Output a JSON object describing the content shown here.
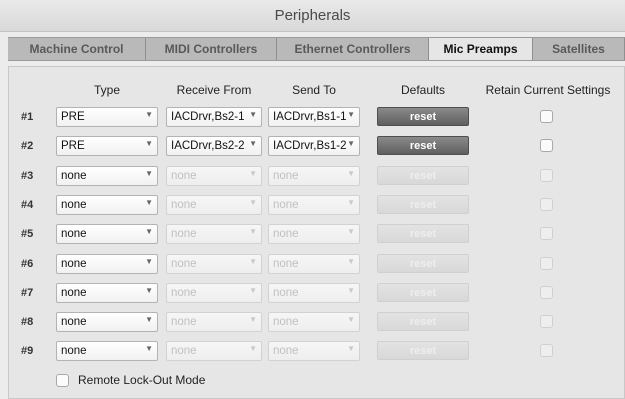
{
  "window": {
    "title": "Peripherals"
  },
  "tabs": [
    {
      "label": "Machine Control"
    },
    {
      "label": "MIDI Controllers"
    },
    {
      "label": "Ethernet Controllers"
    },
    {
      "label": "Mic Preamps",
      "active": true
    },
    {
      "label": "Satellites"
    }
  ],
  "headers": {
    "type": "Type",
    "receive": "Receive From",
    "send": "Send To",
    "defaults": "Defaults",
    "retain": "Retain Current Settings"
  },
  "rows": [
    {
      "num": "#1",
      "type": "PRE",
      "receive": "IACDrvr,Bs2-1",
      "send": "IACDrvr,Bs1-1",
      "reset": "reset",
      "enabled": true
    },
    {
      "num": "#2",
      "type": "PRE",
      "receive": "IACDrvr,Bs2-2",
      "send": "IACDrvr,Bs1-2",
      "reset": "reset",
      "enabled": true
    },
    {
      "num": "#3",
      "type": "none",
      "receive": "none",
      "send": "none",
      "reset": "reset",
      "enabled": false
    },
    {
      "num": "#4",
      "type": "none",
      "receive": "none",
      "send": "none",
      "reset": "reset",
      "enabled": false
    },
    {
      "num": "#5",
      "type": "none",
      "receive": "none",
      "send": "none",
      "reset": "reset",
      "enabled": false
    },
    {
      "num": "#6",
      "type": "none",
      "receive": "none",
      "send": "none",
      "reset": "reset",
      "enabled": false
    },
    {
      "num": "#7",
      "type": "none",
      "receive": "none",
      "send": "none",
      "reset": "reset",
      "enabled": false
    },
    {
      "num": "#8",
      "type": "none",
      "receive": "none",
      "send": "none",
      "reset": "reset",
      "enabled": false
    },
    {
      "num": "#9",
      "type": "none",
      "receive": "none",
      "send": "none",
      "reset": "reset",
      "enabled": false
    }
  ],
  "footer": {
    "remote_lockout_label": "Remote Lock-Out Mode"
  }
}
